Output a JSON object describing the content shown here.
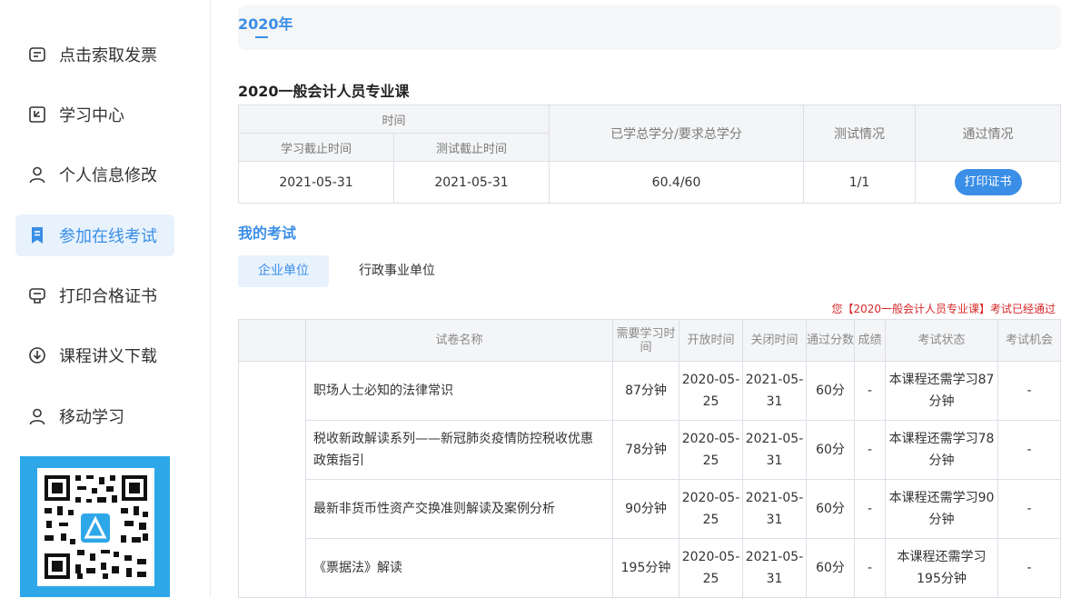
{
  "sidebar": {
    "items": [
      {
        "label": "点击索取发票",
        "icon": "invoice-icon"
      },
      {
        "label": "学习中心",
        "icon": "study-center-icon"
      },
      {
        "label": "个人信息修改",
        "icon": "user-icon"
      },
      {
        "label": "参加在线考试",
        "icon": "bookmark-icon"
      },
      {
        "label": "打印合格证书",
        "icon": "certificate-icon"
      },
      {
        "label": "课程讲义下载",
        "icon": "download-icon"
      },
      {
        "label": "移动学习",
        "icon": "user-icon"
      }
    ],
    "active_index": 3,
    "qr_icon": "qr-code-icon"
  },
  "main": {
    "year_tab": "2020年",
    "course_title": "2020一般会计人员专业课",
    "summary": {
      "headers": {
        "time": "时间",
        "study_deadline": "学习截止时间",
        "test_deadline": "测试截止时间",
        "credits": "已学总学分/要求总学分",
        "test_status": "测试情况",
        "pass_status": "通过情况"
      },
      "row": {
        "study_deadline": "2021-05-31",
        "test_deadline": "2021-05-31",
        "credits": "60.4/60",
        "test_status": "1/1",
        "print_button": "打印证书"
      }
    },
    "my_exams": "我的考试",
    "tabs": [
      "企业单位",
      "行政事业单位"
    ],
    "pass_note": "您【2020一般会计人员专业课】考试已经通过",
    "exam_table": {
      "headers": [
        "试卷名称",
        "需要学习时间",
        "开放时间",
        "关闭时间",
        "通过分数",
        "成绩",
        "考试状态",
        "考试机会"
      ],
      "rows": [
        {
          "name": "职场人士必知的法律常识",
          "study": "87分钟",
          "open": "2020-05-25",
          "close": "2021-05-31",
          "pass": "60分",
          "score": "-",
          "status": "本课程还需学习87分钟",
          "chance": "-"
        },
        {
          "name": "税收新政解读系列——新冠肺炎疫情防控税收优惠政策指引",
          "study": "78分钟",
          "open": "2020-05-25",
          "close": "2021-05-31",
          "pass": "60分",
          "score": "-",
          "status": "本课程还需学习78分钟",
          "chance": "-"
        },
        {
          "name": "最新非货币性资产交换准则解读及案例分析",
          "study": "90分钟",
          "open": "2020-05-25",
          "close": "2021-05-31",
          "pass": "60分",
          "score": "-",
          "status": "本课程还需学习90分钟",
          "chance": "-"
        },
        {
          "name": "《票据法》解读",
          "study": "195分钟",
          "open": "2020-05-25",
          "close": "2021-05-31",
          "pass": "60分",
          "score": "-",
          "status": "本课程还需学习195分钟",
          "chance": "-"
        }
      ]
    }
  },
  "colors": {
    "accent": "#3a8ee6",
    "active_bg": "#e8f2fd",
    "note_red": "#d62828",
    "qr_bg": "#2ea7e8"
  }
}
